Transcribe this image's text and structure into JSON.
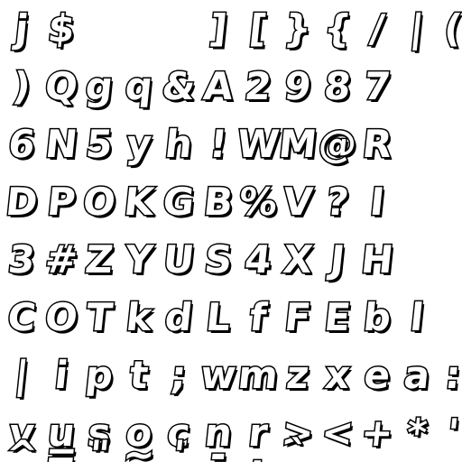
{
  "sheet": {
    "rows": [
      [
        "j",
        "$",
        "",
        "",
        "",
        "]",
        "[",
        "}",
        "{",
        "/",
        "|",
        "("
      ],
      [
        ")",
        "Q",
        "g",
        "q",
        "&",
        "A",
        "2",
        "9",
        "8",
        "7",
        "",
        ""
      ],
      [
        "6",
        "N",
        "5",
        "y",
        "h",
        "!",
        "W",
        "M",
        "@",
        "R",
        "",
        ""
      ],
      [
        "D",
        "P",
        "O",
        "K",
        "G",
        "B",
        "%",
        "V",
        "?",
        "I",
        "",
        ""
      ],
      [
        "3",
        "#",
        "Z",
        "Y",
        "U",
        "S",
        "4",
        "X",
        "J",
        "H",
        "",
        ""
      ],
      [
        "C",
        "O",
        "T",
        "k",
        "d",
        "L",
        "f",
        "F",
        "E",
        "b",
        "l",
        ""
      ],
      [
        "|",
        "i",
        "p",
        "t",
        ";",
        "w",
        "m",
        "z",
        "x",
        "e",
        "a",
        ":"
      ],
      [
        "v",
        "u",
        "s",
        "o",
        "c",
        "n",
        "r",
        ">",
        "<",
        "+",
        "*",
        "'"
      ],
      [
        "^",
        "=",
        "\"",
        "~",
        "'",
        "-",
        ".",
        "`",
        "_",
        "",
        "",
        ""
      ]
    ]
  }
}
